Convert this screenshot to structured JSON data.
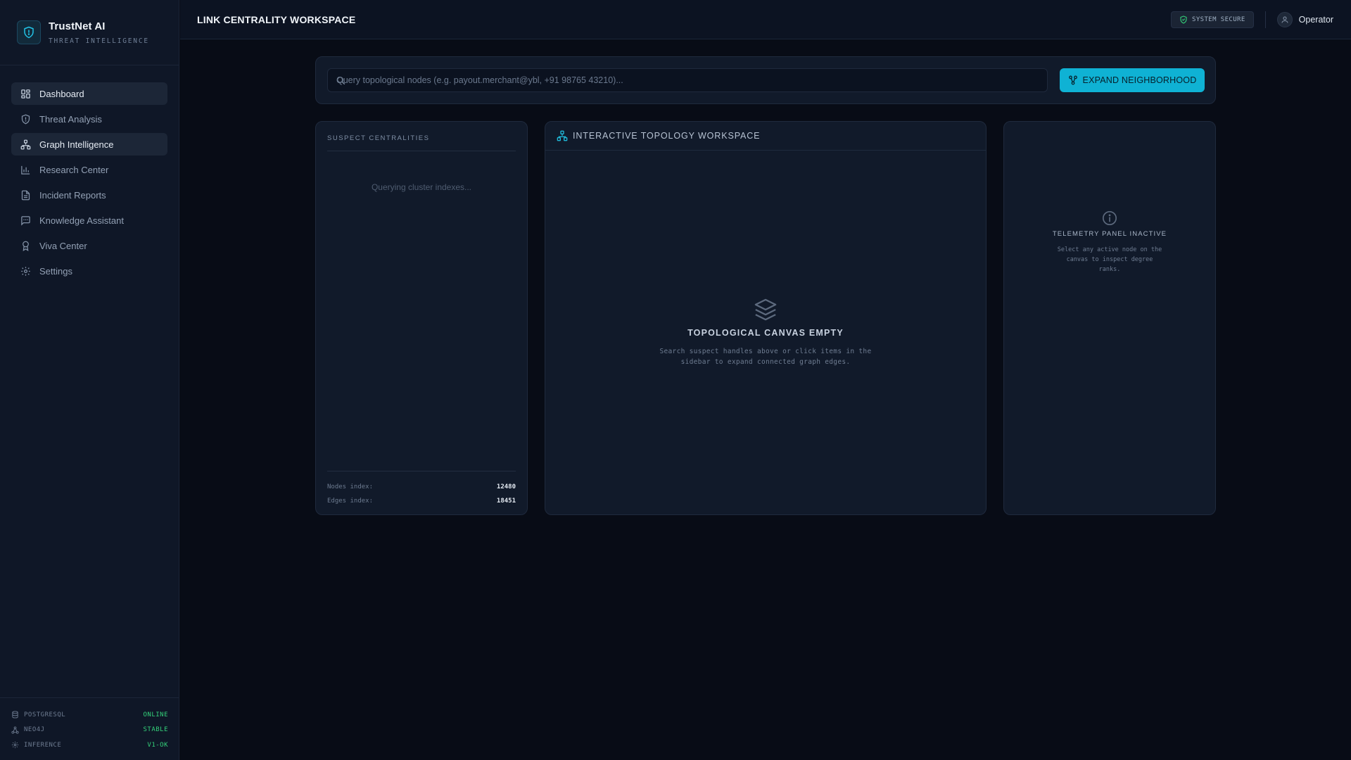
{
  "brand": {
    "name": "TrustNet AI",
    "subtitle": "THREAT INTELLIGENCE"
  },
  "sidebar": {
    "items": [
      {
        "label": "Dashboard",
        "icon": "grid-icon",
        "active": true
      },
      {
        "label": "Threat Analysis",
        "icon": "shield-icon",
        "active": false
      },
      {
        "label": "Graph Intelligence",
        "icon": "network-icon",
        "active": true
      },
      {
        "label": "Research Center",
        "icon": "bar-chart-icon",
        "active": false
      },
      {
        "label": "Incident Reports",
        "icon": "document-icon",
        "active": false
      },
      {
        "label": "Knowledge Assistant",
        "icon": "chat-icon",
        "active": false
      },
      {
        "label": "Viva Center",
        "icon": "award-icon",
        "active": false
      },
      {
        "label": "Settings",
        "icon": "gear-icon",
        "active": false
      }
    ],
    "status": [
      {
        "name": "POSTGRESQL",
        "value": "ONLINE",
        "icon": "database-icon"
      },
      {
        "name": "NEO4J",
        "value": "STABLE",
        "icon": "graph-icon"
      },
      {
        "name": "INFERENCE",
        "value": "V1-OK",
        "icon": "cpu-icon"
      }
    ]
  },
  "header": {
    "title": "LINK CENTRALITY WORKSPACE",
    "badge": "SYSTEM SECURE",
    "user": "Operator"
  },
  "search": {
    "placeholder": "Query topological nodes (e.g. payout.merchant@ybl, +91 98765 43210)...",
    "button_label": "EXPAND NEIGHBORHOOD"
  },
  "left_panel": {
    "title": "SUSPECT CENTRALITIES",
    "loading": "Querying cluster indexes...",
    "nodes_label": "Nodes index:",
    "nodes_value": "12480",
    "edges_label": "Edges index:",
    "edges_value": "18451"
  },
  "mid_panel": {
    "title": "INTERACTIVE TOPOLOGY WORKSPACE",
    "empty_title": "TOPOLOGICAL CANVAS EMPTY",
    "empty_desc": "Search suspect handles above or click items in the sidebar to expand connected graph edges."
  },
  "right_panel": {
    "title": "TELEMETRY PANEL INACTIVE",
    "desc": "Select any active node on the canvas to inspect degree ranks."
  },
  "colors": {
    "accent": "#0fb2d4",
    "status_ok": "#34d17a",
    "background": "#080c16",
    "panel": "#111a2a"
  }
}
